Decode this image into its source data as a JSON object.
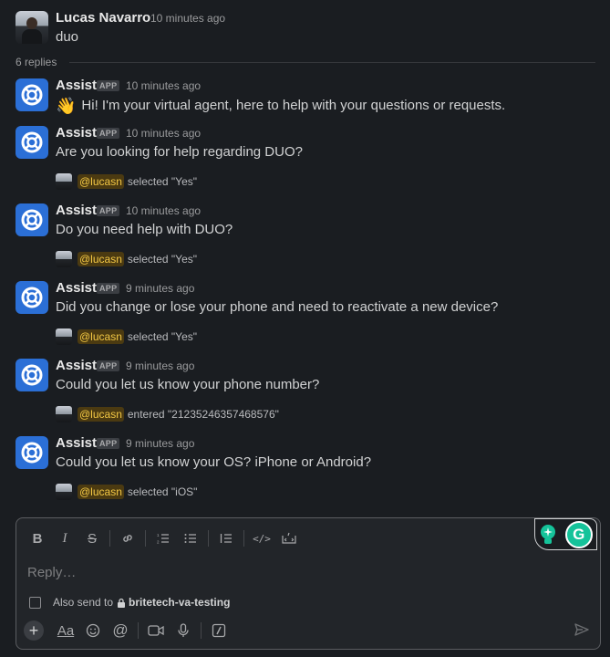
{
  "parent": {
    "author": "Lucas Navarro",
    "time": "10 minutes ago",
    "text": "duo"
  },
  "thread": {
    "replies_label": "6 replies"
  },
  "messages": [
    {
      "sender": "Assist",
      "badge": "APP",
      "time": "10 minutes ago",
      "text": "Hi! I'm your virtual agent, here to help with your questions or requests.",
      "emoji": "👋"
    },
    {
      "sender": "Assist",
      "badge": "APP",
      "time": "10 minutes ago",
      "text": "Are you looking for help regarding DUO?",
      "mention": "@lucasn",
      "action": "selected \"Yes\""
    },
    {
      "sender": "Assist",
      "badge": "APP",
      "time": "10 minutes ago",
      "text": "Do you need help with DUO?",
      "mention": "@lucasn",
      "action": "selected \"Yes\""
    },
    {
      "sender": "Assist",
      "badge": "APP",
      "time": "9 minutes ago",
      "text": "Did you change or lose your phone and need to reactivate a new device?",
      "mention": "@lucasn",
      "action": "selected \"Yes\""
    },
    {
      "sender": "Assist",
      "badge": "APP",
      "time": "9 minutes ago",
      "text": "Could you let us know your phone number?",
      "mention": "@lucasn",
      "action": "entered \"21235246357468576\""
    },
    {
      "sender": "Assist",
      "badge": "APP",
      "time": "9 minutes ago",
      "text": "Could you let us know your OS? iPhone or Android?",
      "mention": "@lucasn",
      "action": "selected \"iOS\""
    }
  ],
  "composer": {
    "placeholder": "Reply…",
    "also_send_label": "Also send to",
    "channel": "britetech-va-testing",
    "format_text_label": "Aa"
  },
  "icons": {
    "bold": "B",
    "italic": "I",
    "strike": "S",
    "link": "link-icon",
    "ordered_list": "ordered-list-icon",
    "bullet_list": "bullet-list-icon",
    "quote": "blockquote-icon",
    "code": "</>",
    "code_block": "code-block-icon",
    "plus": "+",
    "emoji": "emoji-icon",
    "mention": "@",
    "video": "video-icon",
    "mic": "microphone-icon",
    "shortcut": "slash-icon",
    "send": "send-icon",
    "grammarly": "G",
    "assist_bulb": "lightbulb-icon"
  },
  "colors": {
    "background": "#1a1d21",
    "bot_avatar": "#2b6fd6",
    "mention_bg": "#4b3a11",
    "mention_text": "#f2c744",
    "grammarly": "#15c39a"
  }
}
